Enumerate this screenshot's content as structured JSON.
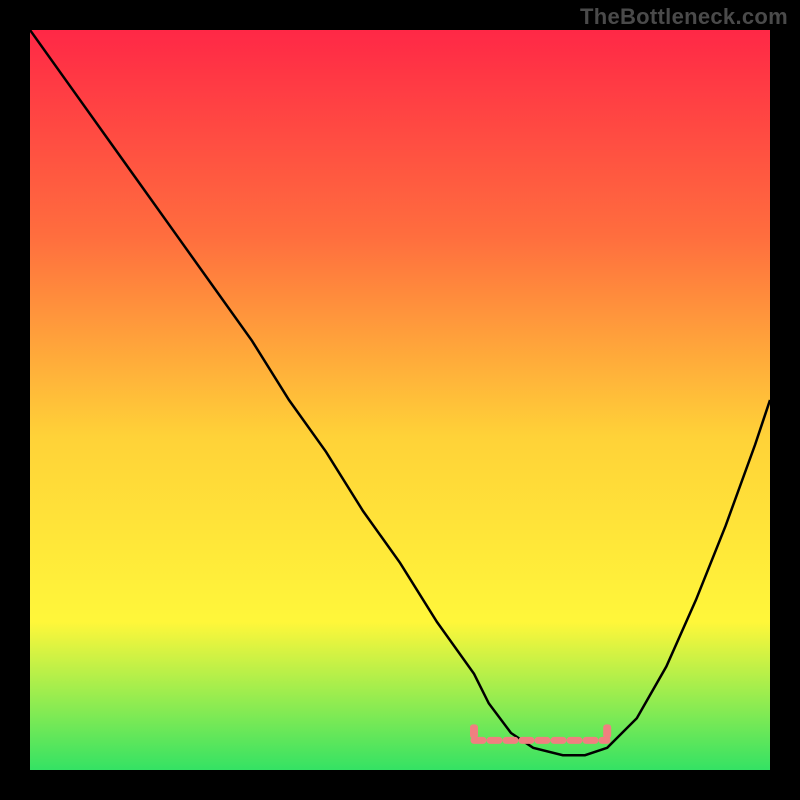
{
  "watermark": "TheBottleneck.com",
  "chart_data": {
    "type": "line",
    "title": "",
    "xlabel": "",
    "ylabel": "",
    "xlim": [
      0,
      100
    ],
    "ylim": [
      0,
      100
    ],
    "background_gradient": {
      "top": "#ff2846",
      "mid_upper": "#ff6e3e",
      "mid": "#ffd238",
      "mid_lower": "#fff73a",
      "bottom": "#34e264"
    },
    "series": [
      {
        "name": "bottleneck-curve",
        "color": "#000000",
        "x": [
          0,
          5,
          10,
          15,
          20,
          25,
          30,
          35,
          40,
          45,
          50,
          55,
          60,
          62,
          65,
          68,
          72,
          75,
          78,
          82,
          86,
          90,
          94,
          98,
          100
        ],
        "y": [
          100,
          93,
          86,
          79,
          72,
          65,
          58,
          50,
          43,
          35,
          28,
          20,
          13,
          9,
          5,
          3,
          2,
          2,
          3,
          7,
          14,
          23,
          33,
          44,
          50
        ]
      },
      {
        "name": "recommended-range-marker",
        "color": "#f08080",
        "type": "segment",
        "x": [
          60,
          78
        ],
        "y": [
          4,
          4
        ]
      }
    ],
    "annotations": []
  }
}
